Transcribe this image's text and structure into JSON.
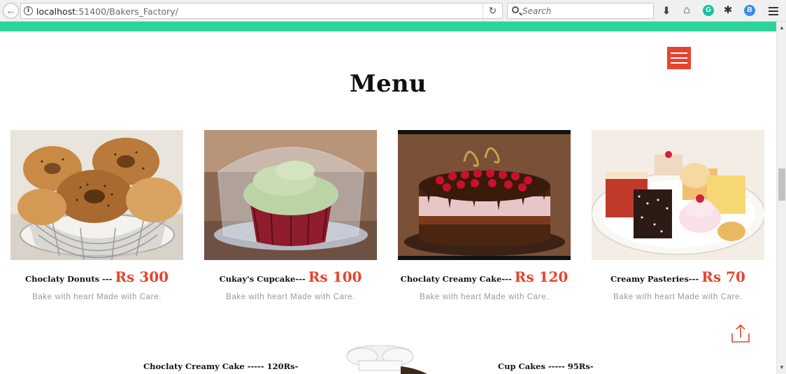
{
  "browser": {
    "url_host": "localhost",
    "url_path": ":51400/Bakers_Factory/",
    "search_placeholder": "Search",
    "icons": [
      "back-icon",
      "info-icon",
      "reload-icon",
      "search-icon",
      "download-icon",
      "home-icon",
      "grammarly-icon",
      "extension-icon",
      "extension-blue-icon",
      "menu-icon"
    ]
  },
  "colors": {
    "accent": "#e8432e",
    "stripe": "#2ed399",
    "description": "#999999"
  },
  "page": {
    "title": "Menu"
  },
  "menu_items": [
    {
      "name": "Choclaty Donuts --- ",
      "price": "Rs 300",
      "description": "Bake with heart Made with Care."
    },
    {
      "name": "Cukay's Cupcake--- ",
      "price": "Rs 100",
      "description": "Bake with heart Made with Care."
    },
    {
      "name": "Choclaty Creamy Cake--- ",
      "price": "Rs 120",
      "description": "Bake with heart Made with Care."
    },
    {
      "name": "Creamy Pasteries--- ",
      "price": "Rs 70",
      "description": "Bake with heart Made with Care."
    }
  ],
  "price_list": {
    "left": "Choclaty Creamy Cake ----- 120Rs-",
    "right": "Cup Cakes ----- 95Rs-"
  }
}
